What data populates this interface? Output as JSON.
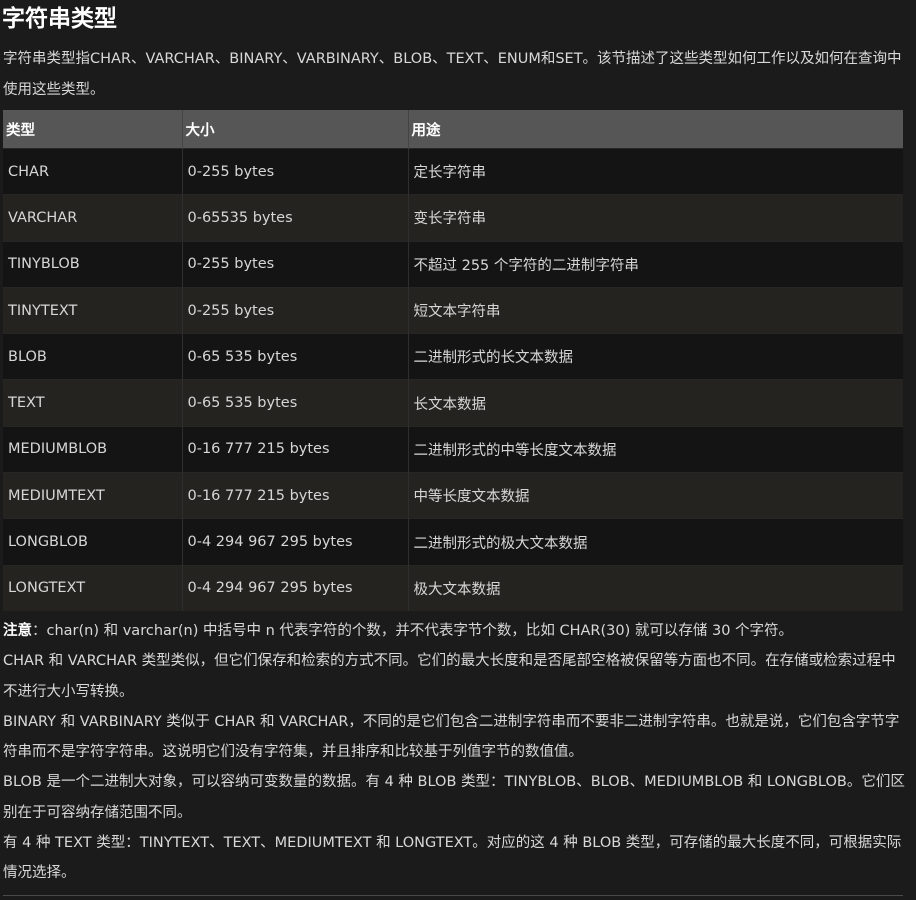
{
  "title": "字符串类型",
  "intro": "字符串类型指CHAR、VARCHAR、BINARY、VARBINARY、BLOB、TEXT、ENUM和SET。该节描述了这些类型如何工作以及如何在查询中使用这些类型。",
  "table": {
    "headers": [
      "类型",
      "大小",
      "用途"
    ],
    "rows": [
      {
        "type": "CHAR",
        "size": "0-255 bytes",
        "usage": "定长字符串"
      },
      {
        "type": "VARCHAR",
        "size": "0-65535 bytes",
        "usage": "变长字符串"
      },
      {
        "type": "TINYBLOB",
        "size": "0-255 bytes",
        "usage": "不超过 255 个字符的二进制字符串"
      },
      {
        "type": "TINYTEXT",
        "size": "0-255 bytes",
        "usage": "短文本字符串"
      },
      {
        "type": "BLOB",
        "size": "0-65 535 bytes",
        "usage": "二进制形式的长文本数据"
      },
      {
        "type": "TEXT",
        "size": "0-65 535 bytes",
        "usage": "长文本数据"
      },
      {
        "type": "MEDIUMBLOB",
        "size": "0-16 777 215 bytes",
        "usage": "二进制形式的中等长度文本数据"
      },
      {
        "type": "MEDIUMTEXT",
        "size": "0-16 777 215 bytes",
        "usage": "中等长度文本数据"
      },
      {
        "type": "LONGBLOB",
        "size": "0-4 294 967 295 bytes",
        "usage": "二进制形式的极大文本数据"
      },
      {
        "type": "LONGTEXT",
        "size": "0-4 294 967 295 bytes",
        "usage": "极大文本数据"
      }
    ]
  },
  "notes": {
    "note_label": "注意",
    "note_text": "：char(n) 和 varchar(n) 中括号中 n 代表字符的个数，并不代表字节个数，比如 CHAR(30) 就可以存储 30 个字符。",
    "para1": "CHAR 和 VARCHAR 类型类似，但它们保存和检索的方式不同。它们的最大长度和是否尾部空格被保留等方面也不同。在存储或检索过程中不进行大小写转换。",
    "para2": "BINARY 和 VARBINARY 类似于 CHAR 和 VARCHAR，不同的是它们包含二进制字符串而不要非二进制字符串。也就是说，它们包含字节字符串而不是字符字符串。这说明它们没有字符集，并且排序和比较基于列值字节的数值值。",
    "para3": "BLOB 是一个二进制大对象，可以容纳可变数量的数据。有 4 种 BLOB 类型：TINYBLOB、BLOB、MEDIUMBLOB 和 LONGBLOB。它们区别在于可容纳存储范围不同。",
    "para4": "有 4 种 TEXT 类型：TINYTEXT、TEXT、MEDIUMTEXT 和 LONGTEXT。对应的这 4 种 BLOB 类型，可存储的最大长度不同，可根据实际情况选择。"
  }
}
